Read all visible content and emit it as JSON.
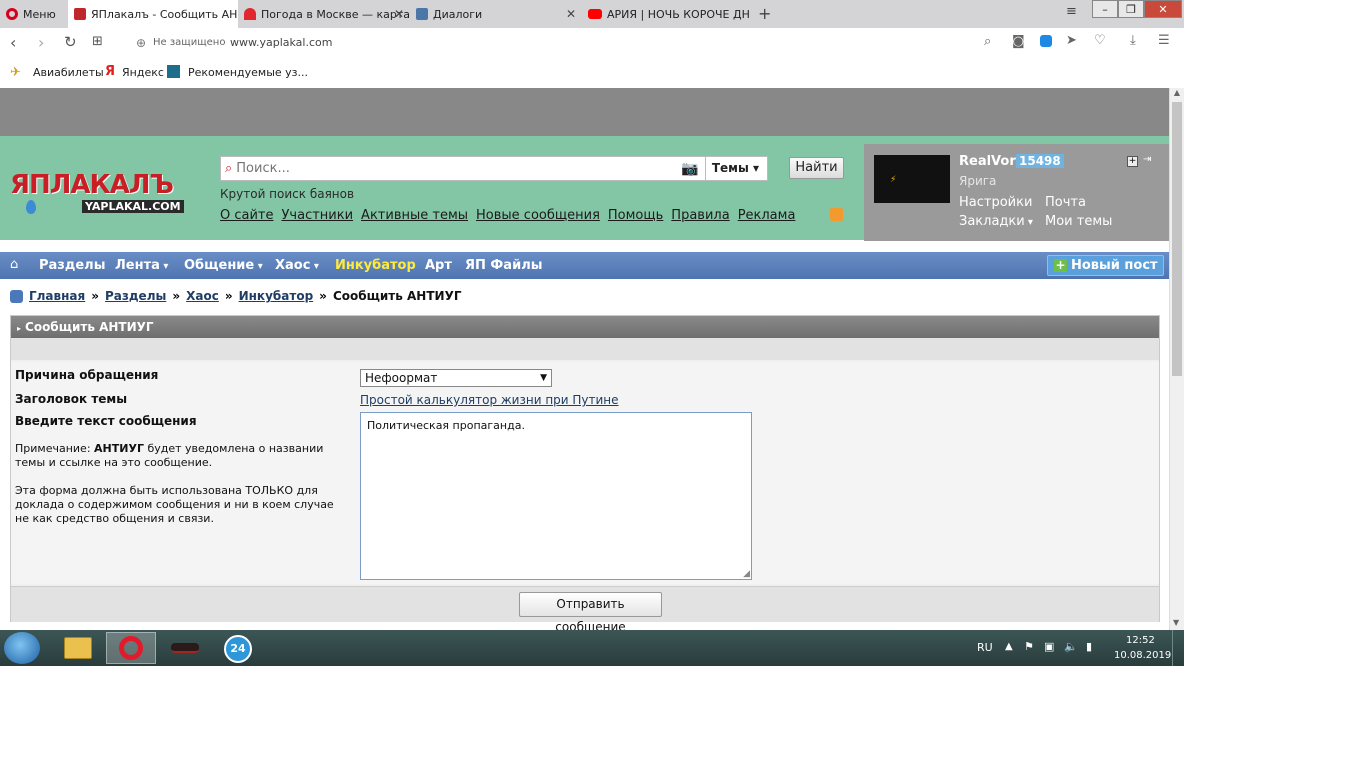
{
  "browser": {
    "menu_label": "Меню",
    "tabs": [
      {
        "label": "ЯПлакалъ - Сообщить АН"
      },
      {
        "label": "Погода в Москве — карта"
      },
      {
        "label": "Диалоги"
      },
      {
        "label": "АРИЯ | НОЧЬ КОРОЧЕ ДН"
      }
    ],
    "security_label": "Не защищено",
    "url": "www.yaplakal.com",
    "bookmarks": [
      "Авиабилеты",
      "Яндекс",
      "Рекомендуемые уз..."
    ]
  },
  "header": {
    "logo_text": "ЯПЛАКАЛЪ",
    "logo_sub": "YAPLAKAL.COM",
    "search_placeholder": "Поиск...",
    "search_scope": "Темы",
    "search_button": "Найти",
    "tagline": "Крутой поиск баянов",
    "links": [
      "О сайте",
      "Участники",
      "Активные темы",
      "Новые сообщения",
      "Помощь",
      "Правила",
      "Реклама"
    ]
  },
  "user": {
    "name": "RealVor",
    "rating": "15498",
    "status": "Ярига",
    "links": [
      "Настройки",
      "Почта",
      "Закладки",
      "Мои темы"
    ]
  },
  "menu": {
    "items": [
      "Разделы",
      "Лента",
      "Общение",
      "Хаос",
      "Инкубатор",
      "Арт",
      "ЯП Файлы"
    ],
    "new_post": "Новый пост"
  },
  "breadcrumb": {
    "items": [
      "Главная",
      "Разделы",
      "Хаос",
      "Инкубатор"
    ],
    "current": "Сообщить АНТИУГ",
    "separator": "»"
  },
  "form": {
    "title": "Сообщить АНТИУГ",
    "reason_label": "Причина обращения",
    "reason_value": "Нефоормат",
    "topic_label": "Заголовок темы",
    "topic_link": "Простой калькулятор жизни при Путине",
    "message_label": "Введите текст сообщения",
    "note_prefix": "Примечание: ",
    "note_bold": "АНТИУГ",
    "note_text": " будет уведомлена о названии темы и ссылке на это сообщение.",
    "note_warning": "Эта форма должна быть использована ТОЛЬКО для доклада о содержимом сообщения и ни в коем случае не как средство общения и связи.",
    "message_value": "Политическая пропаганда.",
    "submit": "Отправить сообщение"
  },
  "taskbar": {
    "lang": "RU",
    "time": "12:52",
    "date": "10.08.2019",
    "badge": "24"
  }
}
